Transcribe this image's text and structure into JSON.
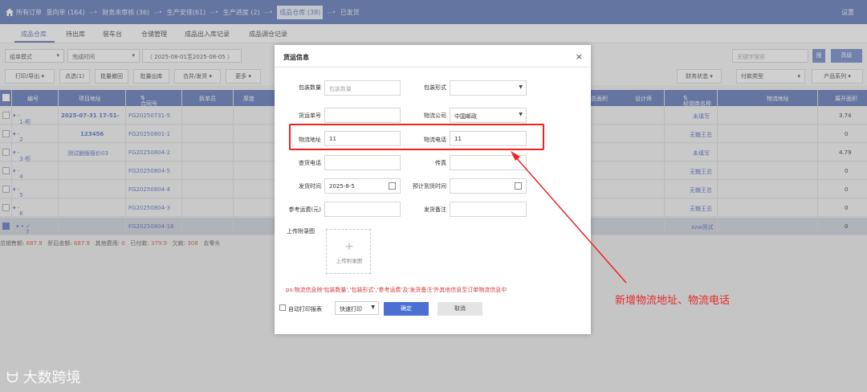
{
  "breadcrumbs": [
    {
      "label": "所有订单"
    },
    {
      "label": "意向单 (164)"
    },
    {
      "label": "财务未审核 (36)"
    },
    {
      "label": "生产安排(61)"
    },
    {
      "label": "生产进度 (2)"
    },
    {
      "label": "成品仓库 (38)"
    },
    {
      "label": "已发货"
    }
  ],
  "crumb_sep": "--•",
  "settings": "设置",
  "subtabs": [
    "成品仓库",
    "待出库",
    "装车台",
    "仓储管理",
    "成品出入库记录",
    "成品调仓记录"
  ],
  "filters": {
    "mode": "组单模式",
    "time": "完成时间",
    "date_range": "2025-08-01至2025-08-05",
    "keyword_placeholder": "关键字搜索",
    "search_btn": "搜",
    "advanced_btn": "高级",
    "finance_status": "财务状态",
    "payment_type": "付款类型",
    "product_series": "产品系列"
  },
  "actions": [
    "打印/导出",
    "点选(1)",
    "批量撤回",
    "批量出库",
    "合并/发货",
    "更多"
  ],
  "table": {
    "headers": {
      "no": "编号",
      "project": "项目地址",
      "contract": "合同号",
      "splitter": "拆单员",
      "thickness": "厚度",
      "total_area": "总面积",
      "designer": "设计师",
      "dealer": "经销商名称",
      "logistics_addr": "物流地址",
      "unfold_area": "展开面积"
    },
    "rows": [
      {
        "no": "1-柜",
        "project": "2025-07-31 17-51-",
        "contract": "FG20250731-5",
        "dealer": "未填写",
        "unfold": "3.74"
      },
      {
        "no": "2",
        "project": "123456",
        "contract": "FG20250801-1",
        "dealer": "无糖王总",
        "unfold": "0"
      },
      {
        "no": "3-柜",
        "project": "测试删版报价03",
        "contract": "FG20250804-2",
        "dealer": "未填写",
        "unfold": "4.79"
      },
      {
        "no": "4",
        "project": "",
        "contract": "FG20250804-5",
        "dealer": "无糖王总",
        "unfold": "0"
      },
      {
        "no": "5",
        "project": "",
        "contract": "FG20250804-4",
        "dealer": "无糖王总",
        "unfold": "0"
      },
      {
        "no": "6",
        "project": "",
        "contract": "FG20250804-3",
        "dealer": "无糖王总",
        "unfold": "0"
      },
      {
        "no": "7",
        "project": "",
        "contract": "FG20250804-16",
        "dealer": "xzw测试",
        "unfold": "0"
      }
    ]
  },
  "summary": {
    "sales_label": "总销售额:",
    "sales": "687.9",
    "discount_label": "折后金额:",
    "discount": "687.9",
    "other_label": "其他费用:",
    "other": "0",
    "paid_label": "已付款:",
    "paid": "379.9",
    "owed_label": "欠款:",
    "owed": "308",
    "rounding_label": "去零头"
  },
  "modal": {
    "title": "货运信息",
    "close": "×",
    "fields": {
      "pack_qty_label": "包装数量",
      "pack_qty_placeholder": "包装数量",
      "pack_form_label": "包装形式",
      "waybill_label": "货运单号",
      "company_label": "物流公司",
      "company_value": "中国邮政",
      "addr_label": "物流地址",
      "addr_value": "11",
      "phone_label": "物流电话",
      "phone_value": "11",
      "query_phone_label": "查货电话",
      "fax_label": "传真",
      "ship_time_label": "发货时间",
      "ship_time_value": "2025-8-5",
      "eta_label": "预计到货时间",
      "ref_fee_label": "参考运费(元)",
      "ship_note_label": "发货备注",
      "upload_label": "上传附录图",
      "upload_btn": "上传附录图"
    },
    "note": "ps:物流信息除'包装数量','包装形式','参考运费'及'发货备注'外其他信息至订单物流信息中",
    "auto_print": "自动打印报表",
    "print_mode": "快速打印",
    "ok": "确定",
    "cancel": "取消"
  },
  "annotation": "新增物流地址、物流电话",
  "watermark": "大数跨境"
}
